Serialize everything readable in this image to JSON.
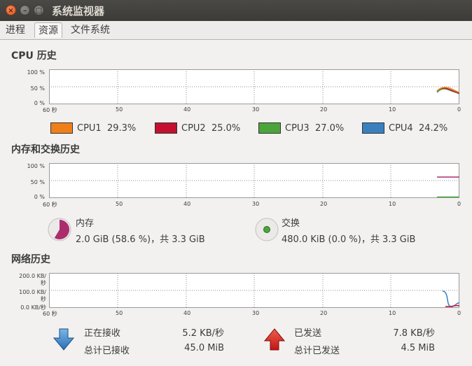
{
  "window": {
    "title": "系统监视器"
  },
  "tabs": [
    {
      "label": "进程"
    },
    {
      "label": "资源"
    },
    {
      "label": "文件系统"
    }
  ],
  "cpu": {
    "title": "CPU 历史",
    "y_labels": [
      "100 %",
      "50 %",
      "0 %"
    ],
    "x_labels": [
      "60 秒",
      "50",
      "40",
      "30",
      "20",
      "10",
      "0"
    ],
    "legend": [
      {
        "label": "CPU1",
        "value": "29.3%",
        "color": "#f07f1a"
      },
      {
        "label": "CPU2",
        "value": "25.0%",
        "color": "#c4102e"
      },
      {
        "label": "CPU3",
        "value": "27.0%",
        "color": "#4ca53c"
      },
      {
        "label": "CPU4",
        "value": "24.2%",
        "color": "#3a80c0"
      }
    ]
  },
  "memory": {
    "title": "内存和交换历史",
    "y_labels": [
      "100 %",
      "50 %",
      "0 %"
    ],
    "x_labels": [
      "60 秒",
      "50",
      "40",
      "30",
      "20",
      "10",
      "0"
    ],
    "mem_label": "内存",
    "mem_value": "2.0 GiB (58.6 %)，共 3.3 GiB",
    "mem_fraction": 0.586,
    "mem_color": "#ab2d6e",
    "swap_label": "交换",
    "swap_value": "480.0 KiB (0.0 %)，共 3.3 GiB",
    "swap_color": "#4ca53c"
  },
  "network": {
    "title": "网络历史",
    "y_labels": [
      "200.0 KB/秒",
      "100.0 KB/秒",
      "0.0 KB/秒"
    ],
    "x_labels": [
      "60 秒",
      "50",
      "40",
      "30",
      "20",
      "10",
      "0"
    ],
    "receiving_label": "正在接收",
    "receiving_value": "5.2 KB/秒",
    "total_received_label": "总计已接收",
    "total_received_value": "45.0 MiB",
    "sent_label": "已发送",
    "sent_value": "7.8 KB/秒",
    "total_sent_label": "总计已发送",
    "total_sent_value": "4.5 MiB",
    "recv_color": "#3a80c0",
    "send_color": "#c4102e"
  }
}
